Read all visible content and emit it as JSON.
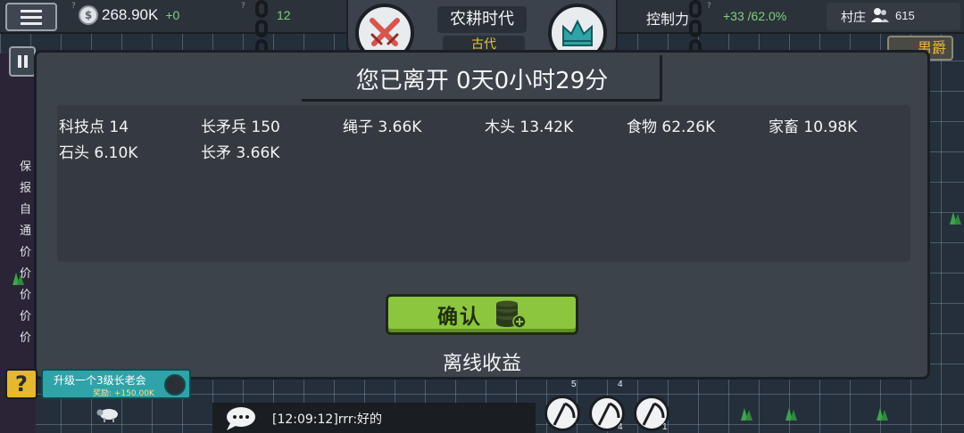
{
  "topbar": {
    "coins": "268.90K",
    "coins_delta": "+0",
    "second_value": "12",
    "era_title": "农耕时代",
    "era_sub": "古代",
    "control_label": "控制力",
    "control_value": "+33 /62.0%",
    "village_label": "村庄",
    "village_value": "615",
    "rank": "男爵"
  },
  "side_list": [
    "保",
    "报",
    "自",
    "通",
    "价",
    "价",
    "价",
    "价",
    "价"
  ],
  "modal": {
    "title": "您已离开 0天0小时29分",
    "resources": [
      "科技点 14",
      "长矛兵 150",
      "绳子 3.66K",
      "木头 13.42K",
      "食物 62.26K",
      "家畜 10.98K",
      "石头 6.10K",
      "长矛 3.66K"
    ],
    "confirm_label": "确认",
    "footer": "离线收益"
  },
  "quest": {
    "help": "?",
    "title": "升级一个3级长老会",
    "reward": "奖励: +150.00K"
  },
  "chat": {
    "message": "[12:09:12]rrr:好的"
  },
  "units": {
    "counts": [
      "5",
      "4",
      "4",
      "1"
    ]
  },
  "colors": {
    "accent_green": "#8cc63f",
    "positive": "#7fd07f",
    "gold": "#e6b830",
    "teal": "#2fa3a8"
  }
}
